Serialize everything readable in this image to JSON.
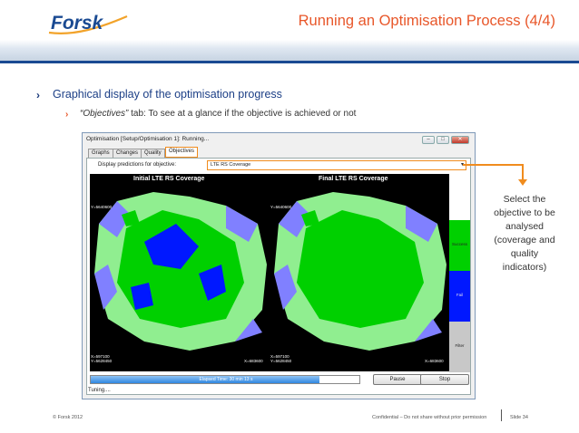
{
  "brand": {
    "logo_text": "Forsk",
    "accent": "#e8572a",
    "navy": "#1a4a92"
  },
  "slide": {
    "title": "Running an Optimisation Process (4/4)"
  },
  "bullets": {
    "main": "Graphical display of the optimisation progress",
    "sub_italic": "“Objectives”",
    "sub_rest": " tab: To see at a glance if the objective is achieved or not"
  },
  "window": {
    "title": "Optimisation [Setup/Optimisation 1]: Running...",
    "tabs": [
      "Graphs",
      "Changes",
      "Quality",
      "Objectives"
    ],
    "active_tab": "Objectives",
    "objective_label": "Display predictions for objective:",
    "objective_value": "LTE RS Coverage",
    "maps": {
      "initial_title": "Initial LTE RS Coverage",
      "final_title": "Final LTE RS Coverage",
      "y_top": "Y=5640600",
      "x_bottom_left": "X=597100",
      "y_bottom_left": "Y=5628450",
      "x_bottom_right": "X=683600"
    },
    "legend": {
      "success": "Success",
      "fail": "Fail",
      "filter": "Filter"
    },
    "progress": {
      "text": "Elapsed Time: 30 min 13 s",
      "fraction": 0.85
    },
    "buttons": {
      "pause": "Pause",
      "stop": "Stop"
    },
    "status": "Tuning...."
  },
  "callout": {
    "lines": [
      "Select the",
      "objective to be",
      "analysed",
      "(coverage and",
      "quality",
      "indicators)"
    ]
  },
  "footer": {
    "left": "© Forsk 2012",
    "center": "Confidential – Do not share without prior permission",
    "right": "Slide 34"
  }
}
